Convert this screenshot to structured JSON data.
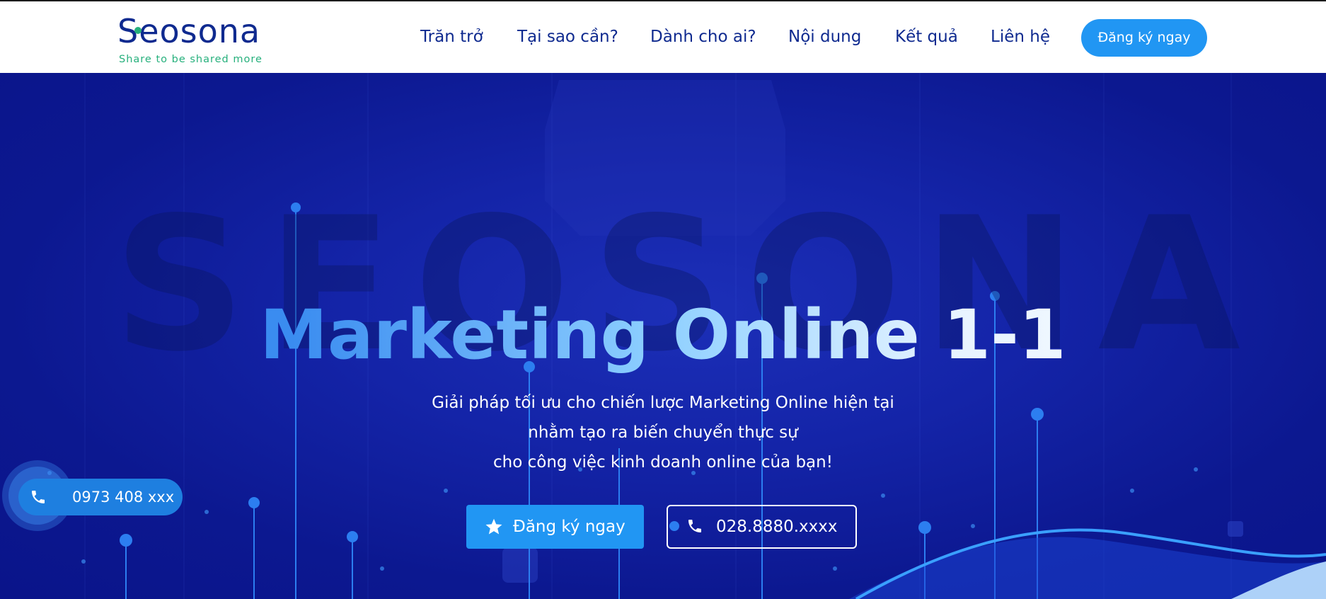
{
  "brand": {
    "name": "Seosona",
    "tagline": "Share to be shared more",
    "watermark": "SEOSONA",
    "colors": {
      "primary": "#0f2a8f",
      "accent": "#2196f3",
      "tagline": "#26b07c"
    }
  },
  "nav": {
    "items": [
      {
        "label": "Trăn trở"
      },
      {
        "label": "Tại sao cần?"
      },
      {
        "label": "Dành cho ai?"
      },
      {
        "label": "Nội dung"
      },
      {
        "label": "Kết quả"
      },
      {
        "label": "Liên hệ"
      }
    ],
    "cta_label": "Đăng ký ngay"
  },
  "hero": {
    "title": "Marketing Online 1-1",
    "subtitle_lines": [
      "Giải pháp tối ưu cho chiến lược Marketing Online hiện tại",
      "nhằm tạo ra biến chuyển thực sự",
      "cho công việc kinh doanh online của bạn!"
    ],
    "primary_button": {
      "label": "Đăng ký ngay",
      "icon": "star-icon"
    },
    "secondary_button": {
      "label": "028.8880.xxxx",
      "icon": "phone-icon"
    }
  },
  "floating_call": {
    "label": "0973 408 xxx",
    "icon": "phone-icon"
  }
}
